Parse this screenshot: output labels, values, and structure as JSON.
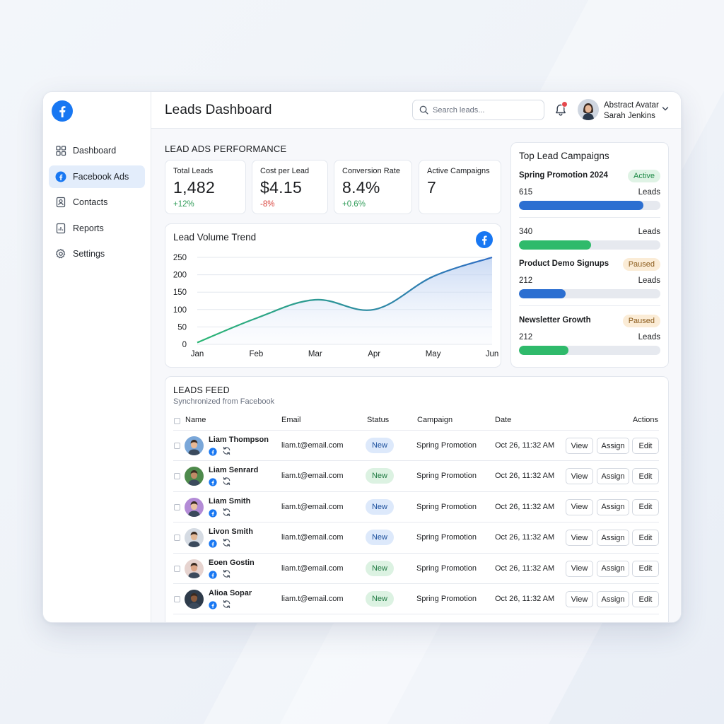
{
  "colors": {
    "brand": "#1877f2",
    "line_start": "#2bb673",
    "line_end": "#2f6dc4",
    "bar_blue": "#2c6fd1",
    "bar_green": "#2fba6b"
  },
  "sidebar": {
    "logo_icon": "facebook-logo-icon",
    "items": [
      {
        "label": "Dashboard",
        "icon": "grid-icon",
        "active": false
      },
      {
        "label": "Facebook Ads",
        "icon": "facebook-icon",
        "active": true
      },
      {
        "label": "Contacts",
        "icon": "contact-card-icon",
        "active": false
      },
      {
        "label": "Reports",
        "icon": "report-icon",
        "active": false
      },
      {
        "label": "Settings",
        "icon": "gear-icon",
        "active": false
      }
    ]
  },
  "header": {
    "title": "Leads Dashboard",
    "search_placeholder": "Search leads...",
    "user_line1": "Abstract Avatar",
    "user_line2": "Sarah Jenkins"
  },
  "performance": {
    "title": "LEAD ADS PERFORMANCE",
    "stats": [
      {
        "label": "Total Leads",
        "value": "1,482",
        "change": "+12%",
        "change_color": "#2e9b57"
      },
      {
        "label": "Cost per Lead",
        "value": "$4.15",
        "change": "-8%",
        "change_color": "#d9453f"
      },
      {
        "label": "Conversion Rate",
        "value": "8.4%",
        "change": "+0.6%",
        "change_color": "#2e9b57"
      },
      {
        "label": "Active Campaigns",
        "value": "7",
        "change": "",
        "change_color": "#2e9b57"
      }
    ]
  },
  "trend": {
    "title": "Lead Volume Trend"
  },
  "chart_data": {
    "type": "area",
    "title": "Lead Volume Trend",
    "x": [
      "Jan",
      "Feb",
      "Mar",
      "Apr",
      "May",
      "Jun"
    ],
    "series": [
      {
        "values": [
          5,
          75,
          128,
          100,
          195,
          250
        ]
      }
    ],
    "yticks": [
      0,
      50,
      100,
      150,
      200,
      250
    ],
    "ylim": [
      0,
      250
    ],
    "grid": true
  },
  "top_campaigns": {
    "title": "Top Lead Campaigns",
    "leads_label": "Leads",
    "items": [
      {
        "name": "Spring Promotion 2024",
        "badge": "Active",
        "count": "615",
        "fill": 0.88,
        "bar_color": "#2c6fd1"
      },
      {
        "name": "",
        "badge": "",
        "count": "340",
        "fill": 0.51,
        "bar_color": "#2fba6b"
      },
      {
        "name": "Product Demo Signups",
        "badge": "Paused",
        "count": "212",
        "fill": 0.33,
        "bar_color": "#2c6fd1"
      },
      {
        "name": "Newsletter Growth",
        "badge": "Paused",
        "count": "212",
        "fill": 0.35,
        "bar_color": "#2fba6b"
      }
    ]
  },
  "feed": {
    "title": "LEADS FEED",
    "subtitle": "Synchronized from Facebook",
    "columns": [
      "Name",
      "Email",
      "Status",
      "Campaign",
      "Date",
      "Actions"
    ],
    "actions": [
      "View",
      "Assign",
      "Edit"
    ],
    "rows": [
      {
        "name": "Liam Thompson",
        "email": "liam.t@email.com",
        "status": "New",
        "status_style": "blue",
        "campaign": "Spring Promotion",
        "date": "Oct 26, 11:32 AM",
        "avatar_bg": "#7aa7d9",
        "skin": "#e8b894"
      },
      {
        "name": "Liam Senrard",
        "email": "liam.t@email.com",
        "status": "New",
        "status_style": "green",
        "campaign": "Spring Promotion",
        "date": "Oct 26, 11:32 AM",
        "avatar_bg": "#4e8a4c",
        "skin": "#c08a66"
      },
      {
        "name": "Liam Smith",
        "email": "liam.t@email.com",
        "status": "New",
        "status_style": "blue",
        "campaign": "Spring Promotion",
        "date": "Oct 26, 11:32 AM",
        "avatar_bg": "#b38bd6",
        "skin": "#e8c1a0"
      },
      {
        "name": "Livon Smith",
        "email": "liam.t@email.com",
        "status": "New",
        "status_style": "blue",
        "campaign": "Spring Promotion",
        "date": "Oct 26, 11:32 AM",
        "avatar_bg": "#d5dbe3",
        "skin": "#e2b896"
      },
      {
        "name": "Eoen Gostin",
        "email": "liam.t@email.com",
        "status": "New",
        "status_style": "green",
        "campaign": "Spring Promotion",
        "date": "Oct 26, 11:32 AM",
        "avatar_bg": "#e6d3cf",
        "skin": "#dca586"
      },
      {
        "name": "Alioa Sopar",
        "email": "liam.t@email.com",
        "status": "New",
        "status_style": "green",
        "campaign": "Spring Promotion",
        "date": "Oct 26, 11:32 AM",
        "avatar_bg": "#2e3b4a",
        "skin": "#8a5a3c"
      }
    ]
  }
}
